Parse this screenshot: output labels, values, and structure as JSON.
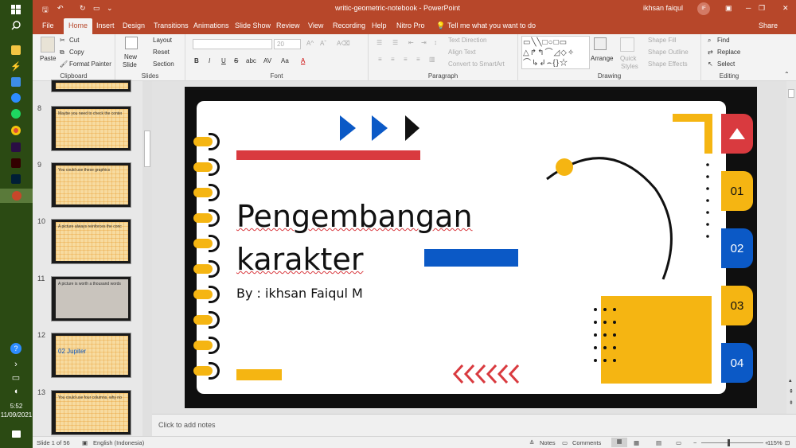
{
  "window": {
    "title": "writic-geometric-notebook  -  PowerPoint",
    "user": "ikhsan faiqul",
    "user_initials": "IF",
    "share": "Share"
  },
  "ribbon_tabs": [
    "File",
    "Home",
    "Insert",
    "Design",
    "Transitions",
    "Animations",
    "Slide Show",
    "Review",
    "View",
    "Recording",
    "Help",
    "Nitro Pro"
  ],
  "tell_me": "Tell me what you want to do",
  "clipboard": {
    "paste": "Paste",
    "cut": "Cut",
    "copy": "Copy",
    "format_painter": "Format Painter",
    "label": "Clipboard"
  },
  "slides_group": {
    "new_slide": "New",
    "new_slide2": "Slide",
    "layout": "Layout",
    "reset": "Reset",
    "section": "Section",
    "label": "Slides"
  },
  "font_group": {
    "size": "20",
    "label": "Font",
    "bold": "B",
    "italic": "I",
    "underline": "U",
    "strike": "S",
    "shadow": "abc",
    "spacing": "AV",
    "case": "Aa",
    "color": "A"
  },
  "paragraph_group": {
    "text_direction": "Text Direction",
    "align_text": "Align Text",
    "smartart": "Convert to SmartArt",
    "label": "Paragraph"
  },
  "drawing_group": {
    "arrange": "Arrange",
    "quick_styles": "Quick",
    "quick_styles2": "Styles",
    "shape_fill": "Shape Fill",
    "shape_outline": "Shape Outline",
    "shape_effects": "Shape Effects",
    "label": "Drawing"
  },
  "editing_group": {
    "find": "Find",
    "replace": "Replace",
    "select": "Select",
    "label": "Editing"
  },
  "thumbnails": [
    {
      "num": "8",
      "title": "Maybe you need to check the content"
    },
    {
      "num": "9",
      "title": "You could use these graphics"
    },
    {
      "num": "10",
      "title": "A picture always reinforces the concept"
    },
    {
      "num": "11",
      "title": "A picture is worth a thousand words"
    },
    {
      "num": "12",
      "title": "02 Jupiter"
    },
    {
      "num": "13",
      "title": "You could use four columns, why not?"
    }
  ],
  "slide": {
    "title_line1": "Pengembangan",
    "title_line2": "karakter",
    "subtitle": "By : ikhsan Faiqul M",
    "tabs": [
      "01",
      "02",
      "03",
      "04"
    ]
  },
  "notes_placeholder": "Click to add notes",
  "status": {
    "slide": "Slide 1 of 56",
    "language": "English (Indonesia)",
    "notes": "Notes",
    "comments": "Comments",
    "zoom": "115%"
  },
  "taskbar": {
    "time": "5:52",
    "date": "11/09/2021"
  },
  "colors": {
    "accent": "#b7472a",
    "yellow": "#f5b512",
    "red": "#d93a3f",
    "blue": "#0b59c6"
  }
}
